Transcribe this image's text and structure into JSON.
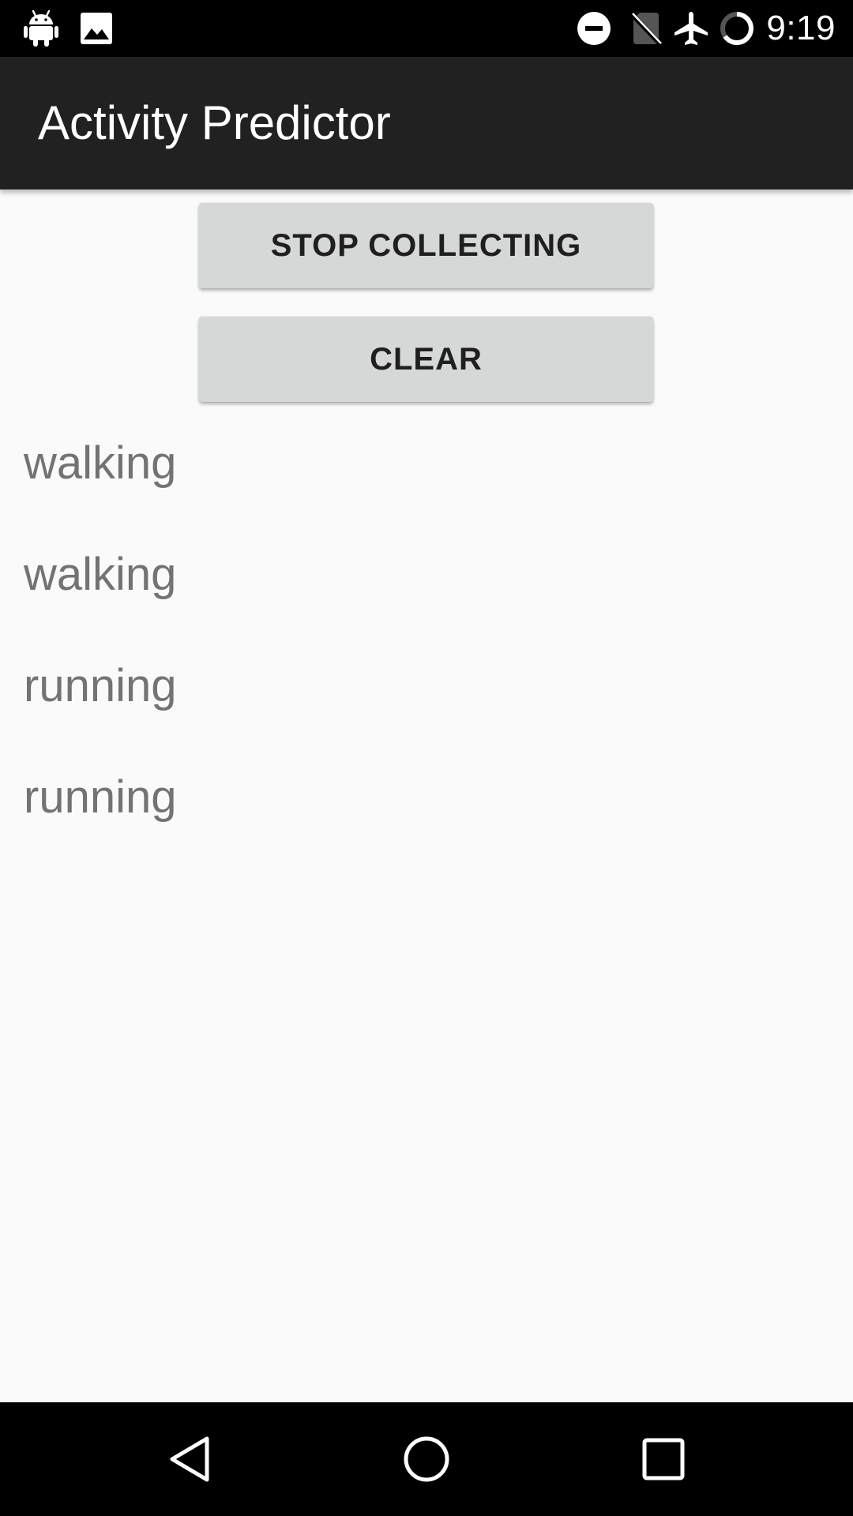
{
  "status_bar": {
    "time": "9:19",
    "left_icons": [
      "android-icon",
      "image-icon"
    ],
    "right_icons": [
      "do-not-disturb-icon",
      "no-sim-icon",
      "airplane-mode-icon",
      "battery-charging-icon"
    ]
  },
  "app_bar": {
    "title": "Activity Predictor"
  },
  "buttons": {
    "stop_label": "STOP COLLECTING",
    "clear_label": "CLEAR"
  },
  "predictions": [
    "walking",
    "walking",
    "running",
    "running"
  ],
  "navigation": {
    "icons": [
      "back-icon",
      "home-icon",
      "recents-icon"
    ]
  },
  "colors": {
    "status_bar": "#000000",
    "app_bar": "#212121",
    "background": "#fafafa",
    "button": "#d6d7d7",
    "prediction_text": "#737373"
  }
}
